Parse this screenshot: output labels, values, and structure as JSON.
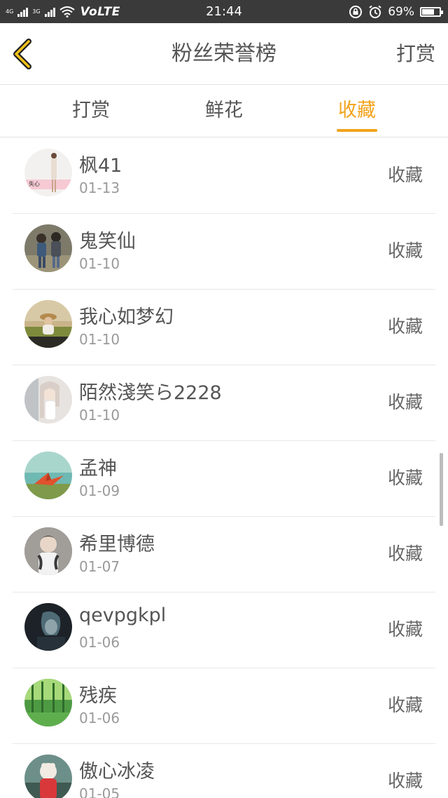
{
  "status_bar": {
    "network_1": "4G",
    "network_2": "3G",
    "volte": "VoLTE",
    "time": "21:44",
    "battery": "69%",
    "battery_level": 0.69
  },
  "header": {
    "title": "粉丝荣誉榜",
    "action": "打赏"
  },
  "tabs": [
    {
      "label": "打赏"
    },
    {
      "label": "鲜花"
    },
    {
      "label": "收藏"
    }
  ],
  "active_tab": "收藏",
  "colors": {
    "accent": "#f2a31b",
    "text": "#555555",
    "subtext": "#9a9a9a",
    "status_bar": "#3a3a3a"
  },
  "rows": [
    {
      "name": "枫41",
      "date": "01-13",
      "type": "收藏",
      "avatar_text": "失心"
    },
    {
      "name": "鬼笑仙",
      "date": "01-10",
      "type": "收藏"
    },
    {
      "name": "我心如梦幻",
      "date": "01-10",
      "type": "收藏"
    },
    {
      "name": "陌然淺笑ら2228",
      "date": "01-10",
      "type": "收藏"
    },
    {
      "name": "孟神",
      "date": "01-09",
      "type": "收藏"
    },
    {
      "name": "希里博德",
      "date": "01-07",
      "type": "收藏"
    },
    {
      "name": "qevpgkpl",
      "date": "01-06",
      "type": "收藏"
    },
    {
      "name": "残疾",
      "date": "01-06",
      "type": "收藏"
    },
    {
      "name": "傲心冰凌",
      "date": "01-05",
      "type": "收藏"
    }
  ]
}
